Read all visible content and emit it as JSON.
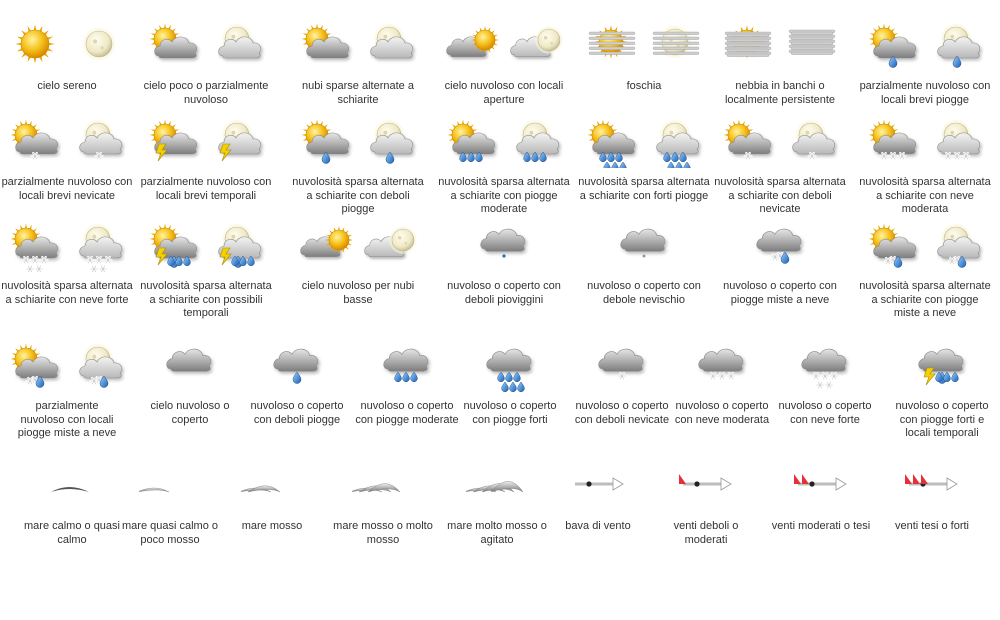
{
  "legend": [
    {
      "label": "cielo sereno",
      "icons": [
        "sun",
        "moon"
      ]
    },
    {
      "label": "cielo poco o parzialmente nuvoloso",
      "icons": [
        "sun-cloud",
        "moon-cloud"
      ]
    },
    {
      "label": "nubi sparse alternate a schiarite",
      "icons": [
        "sun-clouds",
        "moon-clouds"
      ]
    },
    {
      "label": "cielo nuvoloso con locali aperture",
      "icons": [
        "cloud-sun-small",
        "cloud-moon-small"
      ]
    },
    {
      "label": "foschia",
      "icons": [
        "sun-haze",
        "moon-haze"
      ]
    },
    {
      "label": "nebbia in banchi o localmente persistente",
      "icons": [
        "sun-fog",
        "fog"
      ]
    },
    {
      "label": "parzialmente  nuvoloso con locali brevi piogge",
      "icons": [
        "sun-cloud-rain",
        "moon-cloud-rain"
      ]
    },
    {
      "label": "parzialmente  nuvoloso con locali brevi nevicate",
      "icons": [
        "sun-cloud-snow",
        "moon-cloud-snow"
      ]
    },
    {
      "label": "parzialmente  nuvoloso con locali brevi temporali",
      "icons": [
        "sun-cloud-storm",
        "moon-cloud-storm"
      ]
    },
    {
      "label": "nuvolosità sparsa alternata a schiarite con deboli piogge",
      "icons": [
        "sun-cloud-rain",
        "moon-cloud-rain"
      ]
    },
    {
      "label": "nuvolosità sparsa alternata a schiarite con piogge moderate",
      "icons": [
        "sun-cloud-rain3",
        "moon-cloud-rain3"
      ]
    },
    {
      "label": "nuvolosità sparsa alternata a schiarite con forti piogge",
      "icons": [
        "sun-cloud-rain6",
        "moon-cloud-rain6"
      ]
    },
    {
      "label": "nuvolosità sparsa alternata a schiarite con deboli nevicate",
      "icons": [
        "sun-cloud-snow",
        "moon-cloud-snow"
      ]
    },
    {
      "label": "nuvolosità sparsa alternata a schiarite con neve moderata",
      "icons": [
        "sun-cloud-snow3",
        "moon-cloud-snow3"
      ]
    },
    {
      "label": "nuvolosità sparsa alternata a schiarite con neve forte",
      "icons": [
        "sun-cloud-snow5",
        "moon-cloud-snow5"
      ]
    },
    {
      "label": "nuvolosità sparsa alternata a schiarite con possibili temporali",
      "icons": [
        "sun-cloud-storm-rain",
        "moon-cloud-storm-rain"
      ]
    },
    {
      "label": "cielo nuvoloso per nubi basse",
      "icons": [
        "cloud-sun-low",
        "cloud-moon-low"
      ]
    },
    {
      "label": "nuvoloso o coperto con deboli pioviggini",
      "icons": [
        "cloud-drizzle"
      ]
    },
    {
      "label": "nuvoloso o coperto con debole nevischio",
      "icons": [
        "cloud-sleet"
      ]
    },
    {
      "label": "nuvoloso o coperto con piogge miste a neve",
      "icons": [
        "cloud-rain-snow"
      ]
    },
    {
      "label": "nuvolosità sparsa alternate a schiarite con piogge miste a neve",
      "icons": [
        "sun-cloud-rain-snow",
        "moon-cloud-rain-snow"
      ]
    },
    {
      "label": "parzialmente nuvoloso con locali piogge miste a neve",
      "icons": [
        "sun-cloud-rain-snow",
        "moon-cloud-rain-snow"
      ]
    },
    {
      "label": "cielo nuvoloso o coperto",
      "icons": [
        "cloud"
      ]
    },
    {
      "label": "nuvoloso o coperto con deboli piogge",
      "icons": [
        "cloud-rain1"
      ]
    },
    {
      "label": "nuvoloso o coperto con piogge moderate",
      "icons": [
        "cloud-rain3"
      ]
    },
    {
      "label": "nuvoloso o coperto con piogge forti",
      "icons": [
        "cloud-rain6"
      ]
    },
    {
      "label": "nuvoloso o coperto con deboli nevicate",
      "icons": [
        "cloud-snow1"
      ]
    },
    {
      "label": "nuvoloso o coperto con neve moderata",
      "icons": [
        "cloud-snow3"
      ]
    },
    {
      "label": "nuvoloso o coperto con neve forte",
      "icons": [
        "cloud-snow5"
      ]
    },
    {
      "label": "nuvoloso o coperto con piogge forti e locali temporali",
      "icons": [
        "cloud-storm-rain"
      ]
    },
    {
      "label": "mare calmo o quasi calmo",
      "icons": [
        "sea-calm"
      ]
    },
    {
      "label": "mare quasi calmo o poco mosso",
      "icons": [
        "sea-slight"
      ]
    },
    {
      "label": "mare mosso",
      "icons": [
        "sea-moderate"
      ]
    },
    {
      "label": "mare mosso o molto mosso",
      "icons": [
        "sea-rough"
      ]
    },
    {
      "label": "mare molto mosso o agitato",
      "icons": [
        "sea-very-rough"
      ]
    },
    {
      "label": "bava di vento",
      "icons": [
        "wind-calm"
      ]
    },
    {
      "label": "venti deboli o moderati",
      "icons": [
        "wind-1"
      ]
    },
    {
      "label": "venti moderati o tesi",
      "icons": [
        "wind-2"
      ]
    },
    {
      "label": "venti tesi o forti",
      "icons": [
        "wind-3"
      ]
    }
  ]
}
